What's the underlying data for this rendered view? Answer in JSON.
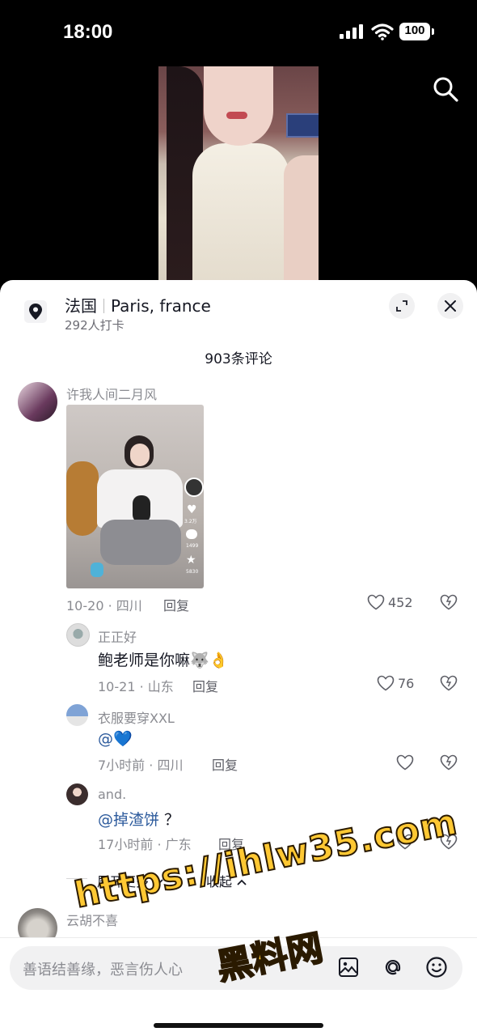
{
  "status_bar": {
    "time": "18:00",
    "battery": "100"
  },
  "location": {
    "name": "法国",
    "english": "Paris, france",
    "checkins": "292人打卡"
  },
  "comments_header": {
    "count_label": "903条评论"
  },
  "comments": [
    {
      "user": "许我人间二月风",
      "date_loc": "10-20 · 四川",
      "reply": "回复",
      "likes": "452"
    },
    {
      "user": "正正好",
      "text": "鲍老师是你嘛🐺👌",
      "date_loc": "10-21 · 山东",
      "reply": "回复",
      "likes": "76"
    },
    {
      "user": "衣服要穿XXL",
      "text": "@💙",
      "date_loc": "7小时前 · 四川",
      "reply": "回复"
    },
    {
      "user": "and.",
      "mention": "@掉渣饼",
      "text_rest": " ？",
      "date_loc": "17小时前 · 广东",
      "reply": "回复"
    },
    {
      "user": "云胡不喜"
    }
  ],
  "attached_image": {
    "like_count": "3.2万",
    "comment_count": "1499",
    "fav_count": "5830"
  },
  "thread_controls": {
    "expand_more": "展开更多",
    "collapse": "收起"
  },
  "input": {
    "placeholder": "善语结善缘，恶言伤人心"
  },
  "watermark": {
    "url": "https://ihlw35.com",
    "cn": "黑料网"
  }
}
